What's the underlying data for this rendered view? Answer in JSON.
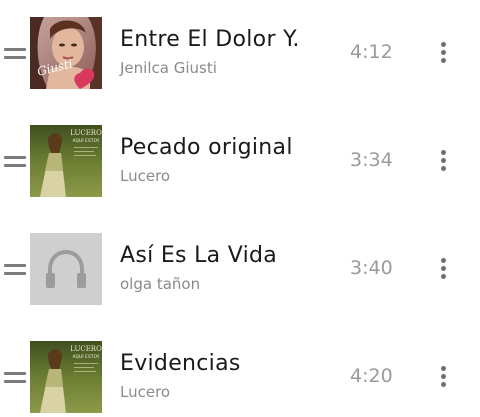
{
  "songs": [
    {
      "title": "Entre El Dolor Y.",
      "artist": "Jenilca Giusti",
      "duration": "4:12",
      "art": "jenilca-album-art"
    },
    {
      "title": "Pecado original",
      "artist": "Lucero",
      "duration": "3:34",
      "art": "lucero-album-art"
    },
    {
      "title": "Así Es La Vida",
      "artist": "olga tañon",
      "duration": "3:40",
      "art": "default-headphones-art"
    },
    {
      "title": "Evidencias",
      "artist": "Lucero",
      "duration": "4:20",
      "art": "lucero-album-art"
    }
  ],
  "album_text": {
    "lucero_name": "LUCERO",
    "lucero_subtitle": "AQUÍ ESTOY",
    "jenilca_script": "Giusti"
  },
  "colors": {
    "title": "#1a1a1a",
    "artist": "#8a8a8a",
    "duration": "#9a9a9a",
    "placeholder_bg": "#cfcfcf",
    "lucero_bg": "#5a6a2a"
  }
}
